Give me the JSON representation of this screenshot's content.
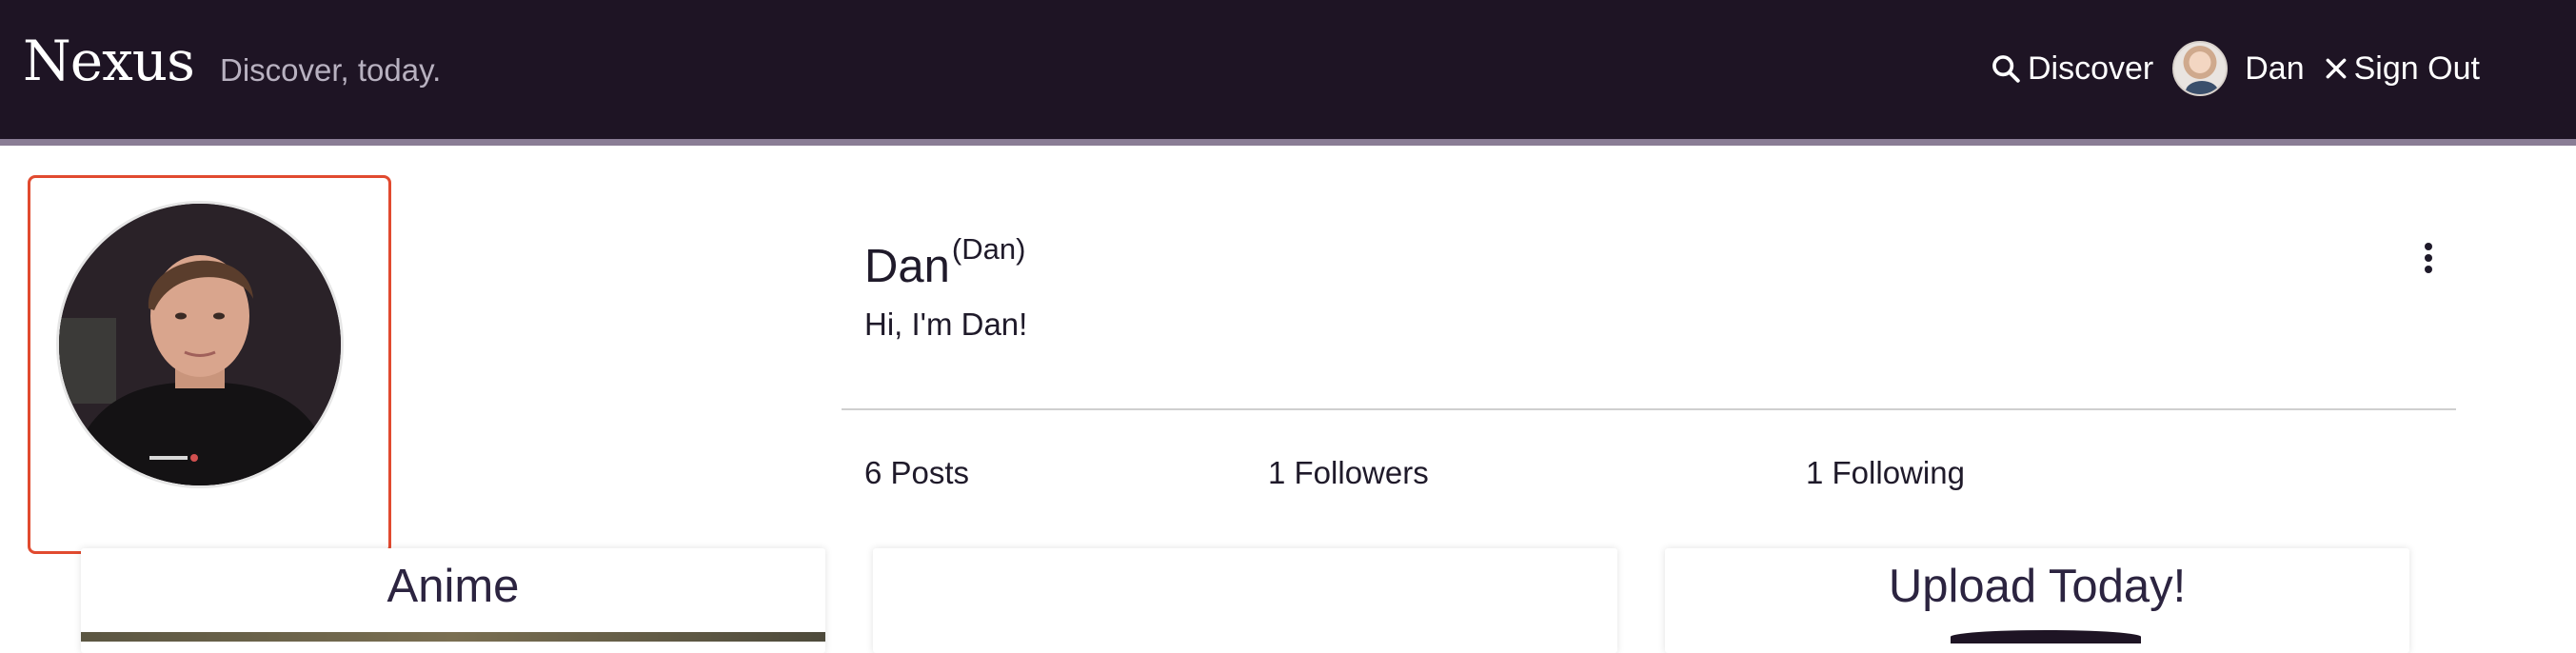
{
  "header": {
    "brand": "Nexus",
    "tagline": "Discover, today.",
    "nav": {
      "discover_label": "Discover",
      "discover_icon": "search-icon",
      "user_label": "Dan",
      "signout_label": "Sign Out",
      "signout_icon": "close-icon"
    }
  },
  "profile": {
    "display_name": "Dan",
    "username": "(Dan)",
    "bio": "Hi, I'm Dan!",
    "menu_icon": "kebab-menu-icon",
    "stats": {
      "posts": "6 Posts",
      "followers": "1 Followers",
      "following": "1 Following"
    }
  },
  "posts": [
    {
      "title": "Anime"
    },
    {
      "title": ""
    },
    {
      "title": "Upload Today!"
    }
  ],
  "colors": {
    "header_bg": "#1e1424",
    "header_border": "#8a7d95",
    "highlight_border": "#e14a2f",
    "text_primary": "#1f1a2a",
    "card_title": "#2c2440"
  }
}
